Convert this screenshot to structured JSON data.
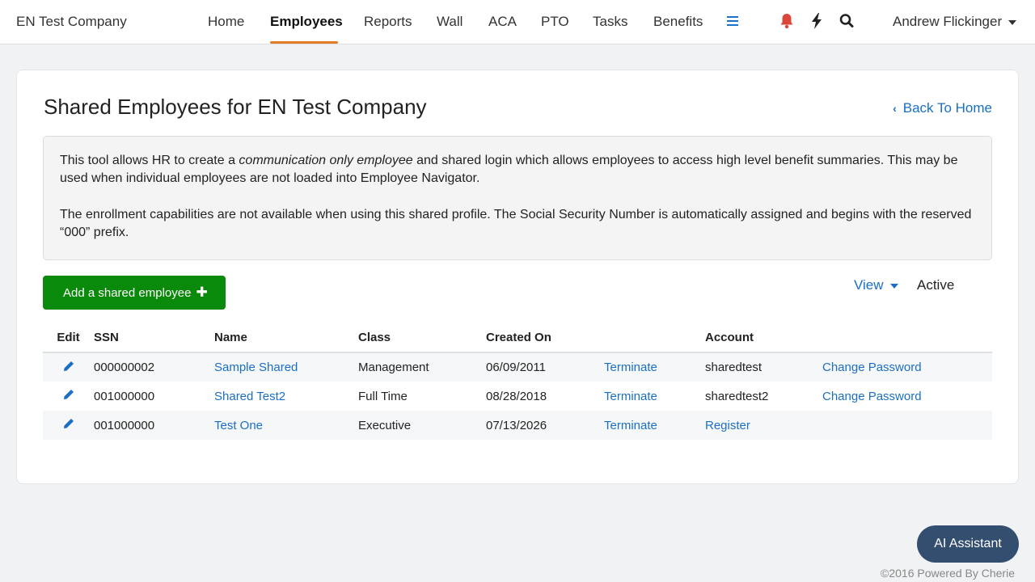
{
  "brand": "EN Test Company",
  "nav": {
    "items": [
      {
        "label": "Home",
        "active": false
      },
      {
        "label": "Employees",
        "active": true
      },
      {
        "label": "Reports",
        "active": false
      },
      {
        "label": "Wall",
        "active": false
      },
      {
        "label": "ACA",
        "active": false
      },
      {
        "label": "PTO",
        "active": false
      },
      {
        "label": "Tasks",
        "active": false
      },
      {
        "label": "Benefits",
        "active": false
      }
    ],
    "icons": [
      "menu-icon",
      "bell-icon",
      "bolt-icon",
      "search-icon"
    ],
    "user": "Andrew Flickinger"
  },
  "page": {
    "title": "Shared Employees for EN Test Company",
    "back_link": "Back To Home",
    "info": {
      "p1_before": "This tool allows HR to create a ",
      "p1_em": "communication only employee",
      "p1_after": " and shared login which allows employees to access high level benefit summaries.  This may be used when individual employees are not loaded into Employee Navigator.",
      "p2": "The enrollment capabilities are not available when using this shared profile.  The Social Security Number is automatically assigned and begins with the reserved “000” prefix."
    },
    "add_button": "Add a shared employee",
    "view_label": "View",
    "view_status": "Active"
  },
  "table": {
    "headers": {
      "edit": "Edit",
      "ssn": "SSN",
      "name": "Name",
      "class": "Class",
      "created": "Created On",
      "terminate": "",
      "account": "Account",
      "password": ""
    },
    "rows": [
      {
        "ssn": "000000002",
        "name": "Sample Shared",
        "class": "Management",
        "created": "06/09/2011",
        "terminate": "Terminate",
        "account": "sharedtest",
        "password": "Change Password"
      },
      {
        "ssn": "001000000",
        "name": "Shared Test2",
        "class": "Full Time",
        "created": "08/28/2018",
        "terminate": "Terminate",
        "account": "sharedtest2",
        "password": "Change Password"
      },
      {
        "ssn": "001000000",
        "name": "Test One",
        "class": "Executive",
        "created": "07/13/2026",
        "terminate": "Terminate",
        "account": "Register",
        "password": ""
      }
    ]
  },
  "ai_button": "AI Assistant",
  "footer": "©2016 Powered By Cherie",
  "colors": {
    "accent": "#1a6fc4",
    "add_button": "#0a8a0a",
    "nav_underline": "#e07b26",
    "bell": "#d9473a",
    "ai_button": "#334e6e"
  }
}
